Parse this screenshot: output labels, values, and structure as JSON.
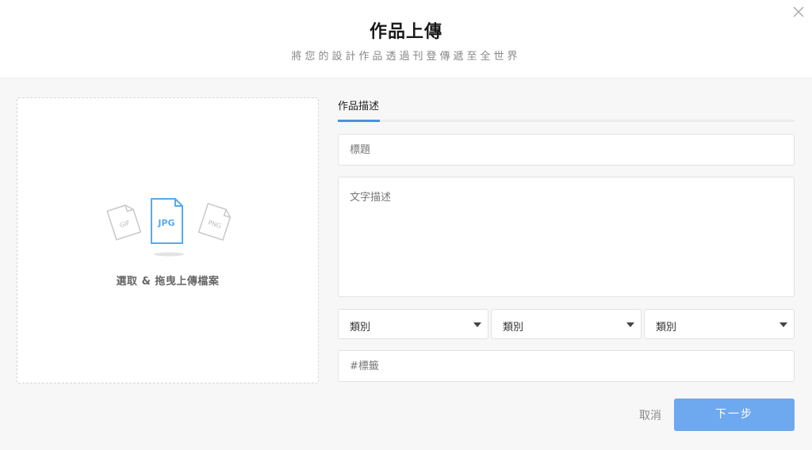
{
  "header": {
    "title": "作品上傳",
    "subtitle": "將您的設計作品透過刊登傳遞至全世界"
  },
  "upload": {
    "instruction": "選取 & 拖曳上傳檔案",
    "file_types": [
      "GIF",
      "JPG",
      "PNG"
    ]
  },
  "tabs": [
    {
      "label": "作品描述",
      "active": true
    }
  ],
  "form": {
    "title_placeholder": "標題",
    "description_placeholder": "文字描述",
    "categories": [
      {
        "label": "類別"
      },
      {
        "label": "類別"
      },
      {
        "label": "類別"
      }
    ],
    "tags_placeholder": "#標籤"
  },
  "actions": {
    "cancel_label": "取消",
    "next_label": "下一步"
  },
  "colors": {
    "accent": "#4a90e2",
    "primary_button": "#6ea8ef",
    "icon_active": "#5aa9e6",
    "icon_muted": "#c8c8c8"
  }
}
